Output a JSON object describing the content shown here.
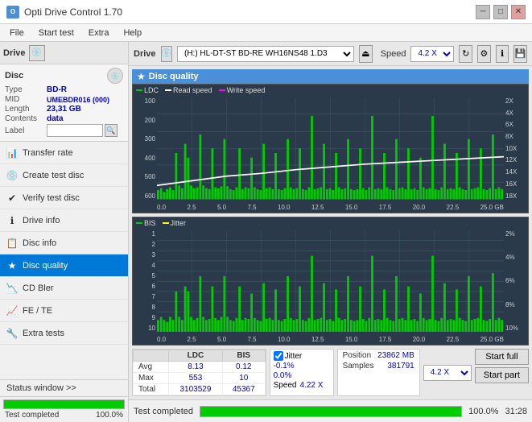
{
  "app": {
    "title": "Opti Drive Control 1.70",
    "icon": "O"
  },
  "titlebar": {
    "minimize": "─",
    "maximize": "□",
    "close": "✕"
  },
  "menu": {
    "items": [
      "File",
      "Start test",
      "Extra",
      "Help"
    ]
  },
  "drive_section": {
    "label": "Drive",
    "drive_value": "(H:) HL-DT-ST BD-RE  WH16NS48 1.D3",
    "speed_label": "Speed",
    "speed_value": "4.2 X"
  },
  "disc": {
    "title": "Disc",
    "type_label": "Type",
    "type_value": "BD-R",
    "mid_label": "MID",
    "mid_value": "UMEBDR016 (000)",
    "length_label": "Length",
    "length_value": "23,31 GB",
    "contents_label": "Contents",
    "contents_value": "data",
    "label_label": "Label"
  },
  "nav": {
    "items": [
      {
        "id": "transfer-rate",
        "label": "Transfer rate",
        "icon": "📊"
      },
      {
        "id": "create-test-disc",
        "label": "Create test disc",
        "icon": "💿"
      },
      {
        "id": "verify-test-disc",
        "label": "Verify test disc",
        "icon": "✔"
      },
      {
        "id": "drive-info",
        "label": "Drive info",
        "icon": "ℹ"
      },
      {
        "id": "disc-info",
        "label": "Disc info",
        "icon": "📋"
      },
      {
        "id": "disc-quality",
        "label": "Disc quality",
        "icon": "★",
        "active": true
      },
      {
        "id": "cd-bler",
        "label": "CD Bler",
        "icon": "📉"
      },
      {
        "id": "fe-te",
        "label": "FE / TE",
        "icon": "📈"
      },
      {
        "id": "extra-tests",
        "label": "Extra tests",
        "icon": "🔧"
      }
    ]
  },
  "status_window": {
    "label": "Status window >>"
  },
  "progress": {
    "pct": 100.0,
    "pct_text": "100.0%",
    "status": "Test completed",
    "time": "31:28"
  },
  "disc_quality": {
    "title": "Disc quality",
    "icon": "★",
    "legend": {
      "ldc_label": "LDC",
      "read_speed_label": "Read speed",
      "write_speed_label": "Write speed"
    },
    "chart1": {
      "y_labels": [
        "600",
        "500",
        "400",
        "300",
        "200",
        "100"
      ],
      "y_labels_right": [
        "18X",
        "16X",
        "14X",
        "12X",
        "10X",
        "8X",
        "6X",
        "4X",
        "2X"
      ],
      "x_labels": [
        "0.0",
        "2.5",
        "5.0",
        "7.5",
        "10.0",
        "12.5",
        "15.0",
        "17.5",
        "20.0",
        "22.5",
        "25.0 GB"
      ]
    },
    "legend2": {
      "bis_label": "BIS",
      "jitter_label": "Jitter"
    },
    "chart2": {
      "y_labels": [
        "10",
        "9",
        "8",
        "7",
        "6",
        "5",
        "4",
        "3",
        "2",
        "1"
      ],
      "y_labels_right": [
        "10%",
        "8%",
        "6%",
        "4%",
        "2%"
      ],
      "x_labels": [
        "0.0",
        "2.5",
        "5.0",
        "7.5",
        "10.0",
        "12.5",
        "15.0",
        "17.5",
        "20.0",
        "22.5",
        "25.0 GB"
      ]
    }
  },
  "stats": {
    "columns": [
      "",
      "LDC",
      "BIS",
      "",
      "Jitter",
      "Speed"
    ],
    "rows": [
      {
        "label": "Avg",
        "ldc": "8.13",
        "bis": "0.12",
        "jitter": "-0.1%",
        "speed": "4.22 X"
      },
      {
        "label": "Max",
        "ldc": "553",
        "bis": "10",
        "jitter": "0.0%"
      },
      {
        "label": "Total",
        "ldc": "3103529",
        "bis": "45367",
        "jitter": ""
      }
    ],
    "position_label": "Position",
    "position_value": "23862 MB",
    "samples_label": "Samples",
    "samples_value": "381791",
    "speed_select": "4.2 X",
    "jitter_checked": true,
    "jitter_label": "Jitter"
  },
  "buttons": {
    "start_full": "Start full",
    "start_part": "Start part"
  },
  "colors": {
    "ldc": "#00cc00",
    "read_speed": "#ffffff",
    "write_speed": "#ff00ff",
    "bis": "#00cc00",
    "jitter": "#ffff00",
    "chart_bg": "#2a3a4a",
    "grid": "#3d5a6d",
    "active_nav": "#0078d7",
    "accent": "#0000cc"
  }
}
